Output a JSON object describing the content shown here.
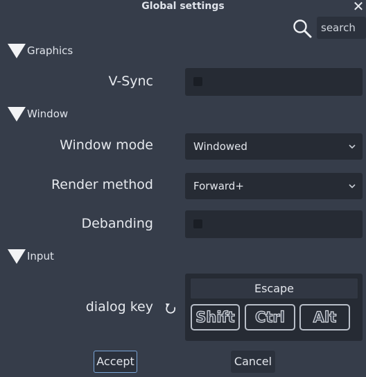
{
  "dialog": {
    "title": "Global settings"
  },
  "search": {
    "placeholder": "search"
  },
  "sections": {
    "graphics": {
      "label": "Graphics"
    },
    "window": {
      "label": "Window"
    },
    "input": {
      "label": "Input"
    }
  },
  "settings": {
    "vsync": {
      "label": "V-Sync",
      "checked": false
    },
    "window_mode": {
      "label": "Window mode",
      "value": "Windowed"
    },
    "render_method": {
      "label": "Render method",
      "value": "Forward+"
    },
    "debanding": {
      "label": "Debanding",
      "checked": false
    },
    "dialog_key": {
      "label": "dialog key",
      "key": "Escape",
      "modifiers": [
        "Shift",
        "Ctrl",
        "Alt"
      ]
    }
  },
  "buttons": {
    "accept": "Accept",
    "cancel": "Cancel"
  },
  "icons": {
    "close": "close-icon",
    "search": "search-icon",
    "collapse": "triangle-down-icon",
    "dropdown": "chevron-down-icon",
    "reset": "reset-icon"
  },
  "colors": {
    "background": "#363d4a",
    "field": "#262b34",
    "accent": "#7aa6d8"
  }
}
